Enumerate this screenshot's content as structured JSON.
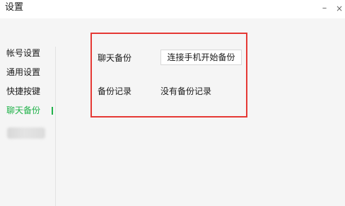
{
  "window": {
    "title": "设置",
    "minimize_glyph": "–",
    "close_glyph": "×"
  },
  "sidebar": {
    "items": [
      {
        "label": "帐号设置",
        "active": false
      },
      {
        "label": "通用设置",
        "active": false
      },
      {
        "label": "快捷按键",
        "active": false
      },
      {
        "label": "聊天备份",
        "active": true
      }
    ]
  },
  "main": {
    "chat_backup_label": "聊天备份",
    "backup_button_label": "连接手机开始备份",
    "backup_records_label": "备份记录",
    "backup_records_value": "没有备份记录"
  },
  "colors": {
    "accent": "#21b24a",
    "highlight": "#e53935",
    "background": "#f5f5f5"
  },
  "icons": {
    "minimize": "minimize-icon",
    "close": "close-icon"
  }
}
